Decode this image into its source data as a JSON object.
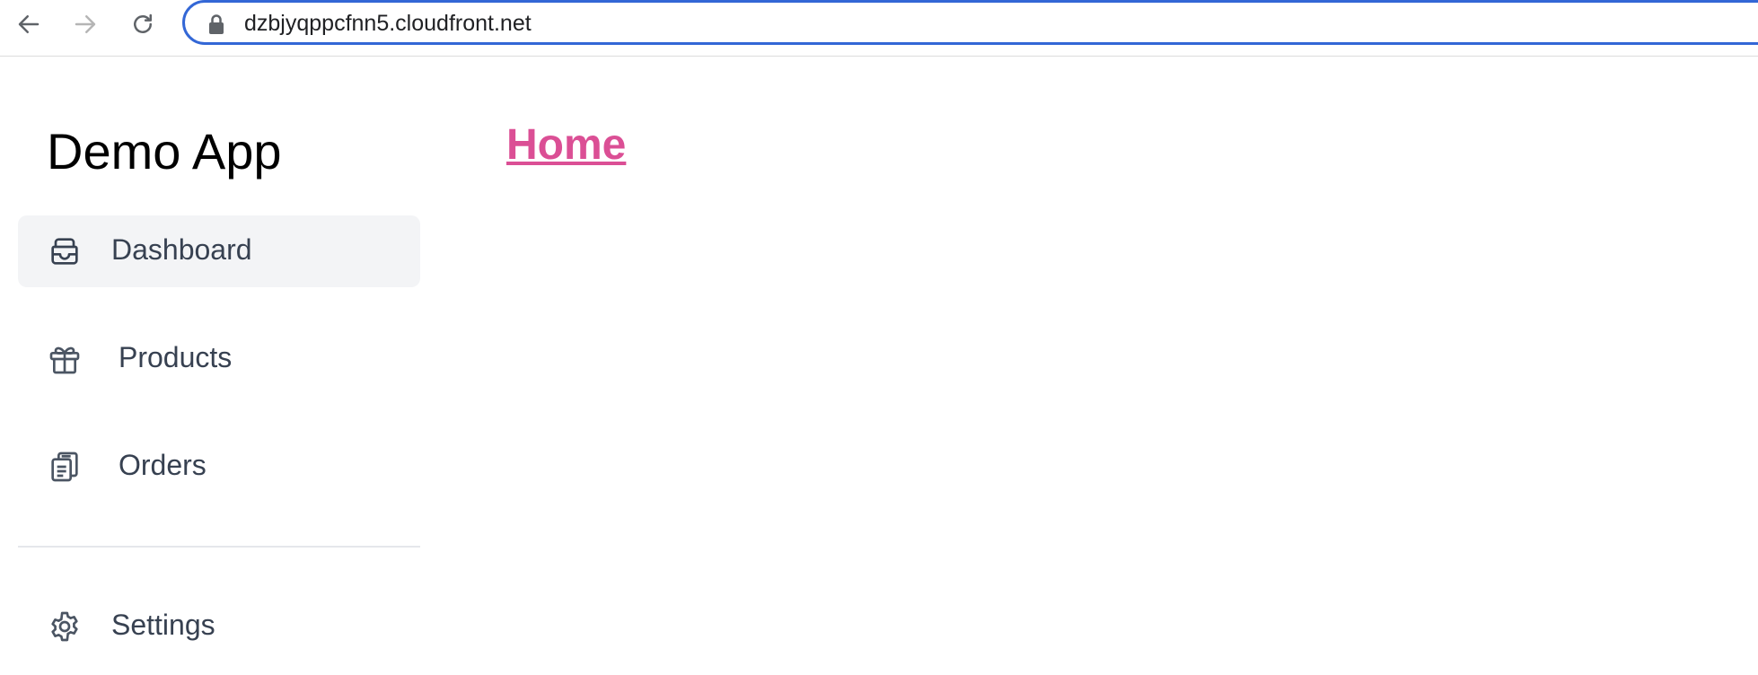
{
  "browser": {
    "url": "dzbjyqppcfnn5.cloudfront.net",
    "icons": [
      "back-arrow-icon",
      "forward-arrow-icon",
      "reload-icon",
      "lock-icon"
    ]
  },
  "sidebar": {
    "app_title": "Demo App",
    "items": [
      {
        "label": "Dashboard",
        "icon": "inbox-stack-icon",
        "active": true
      },
      {
        "label": "Products",
        "icon": "gift-icon",
        "active": false
      },
      {
        "label": "Orders",
        "icon": "clipboard-document-icon",
        "active": false
      }
    ],
    "settings": {
      "label": "Settings",
      "icon": "gear-icon"
    }
  },
  "main": {
    "home_link": "Home"
  },
  "colors": {
    "accent_link": "#db4f95",
    "url_focus_border": "#3367d6",
    "nav_text": "#374151",
    "active_bg": "#f3f4f6"
  }
}
